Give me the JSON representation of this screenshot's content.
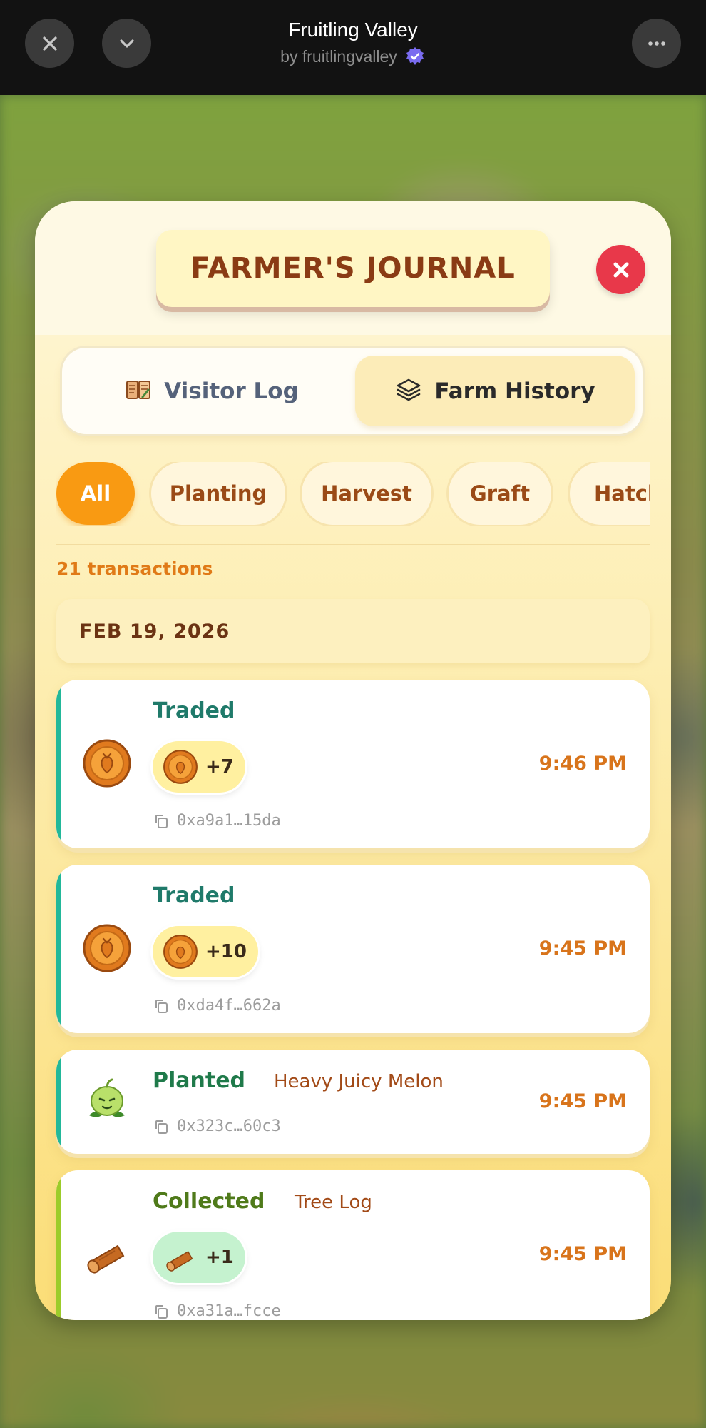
{
  "topbar": {
    "title": "Fruitling Valley",
    "subtitle": "by fruitlingvalley",
    "close_icon": "close-icon",
    "collapse_icon": "chevron-down-icon",
    "more_icon": "more-icon"
  },
  "journal": {
    "title": "FARMER'S JOURNAL",
    "tabs": [
      {
        "label": "Visitor Log",
        "icon": "book-icon",
        "active": false
      },
      {
        "label": "Farm History",
        "icon": "layers-icon",
        "active": true
      }
    ],
    "filters": [
      {
        "label": "All",
        "active": true
      },
      {
        "label": "Planting",
        "active": false
      },
      {
        "label": "Harvest",
        "active": false
      },
      {
        "label": "Graft",
        "active": false
      },
      {
        "label": "Hatch",
        "active": false
      }
    ],
    "transaction_count": "21 transactions",
    "date_group": "FEB 19, 2026",
    "transactions": [
      {
        "action": "Traded",
        "item": "",
        "reward": "+7",
        "reward_icon": "coin-icon",
        "time": "9:46 PM",
        "hash": "0xa9a1…15da",
        "accent": "#22b89a"
      },
      {
        "action": "Traded",
        "item": "",
        "reward": "+10",
        "reward_icon": "coin-icon",
        "time": "9:45 PM",
        "hash": "0xda4f…662a",
        "accent": "#22b89a"
      },
      {
        "action": "Planted",
        "item": "Heavy Juicy Melon",
        "reward": "",
        "time": "9:45 PM",
        "hash": "0x323c…60c3",
        "accent": "#22b89a"
      },
      {
        "action": "Collected",
        "item": "Tree Log",
        "reward": "+1",
        "reward_icon": "log-icon",
        "time": "9:45 PM",
        "hash": "0xa31a…fcce",
        "accent": "#9ccc2a"
      }
    ]
  },
  "colors": {
    "accent_orange": "#f99a12",
    "traded_green": "#1f7a6a",
    "planted_green": "#1f7a4a",
    "collected_green": "#4f7a1a",
    "close_red": "#e8384a"
  }
}
